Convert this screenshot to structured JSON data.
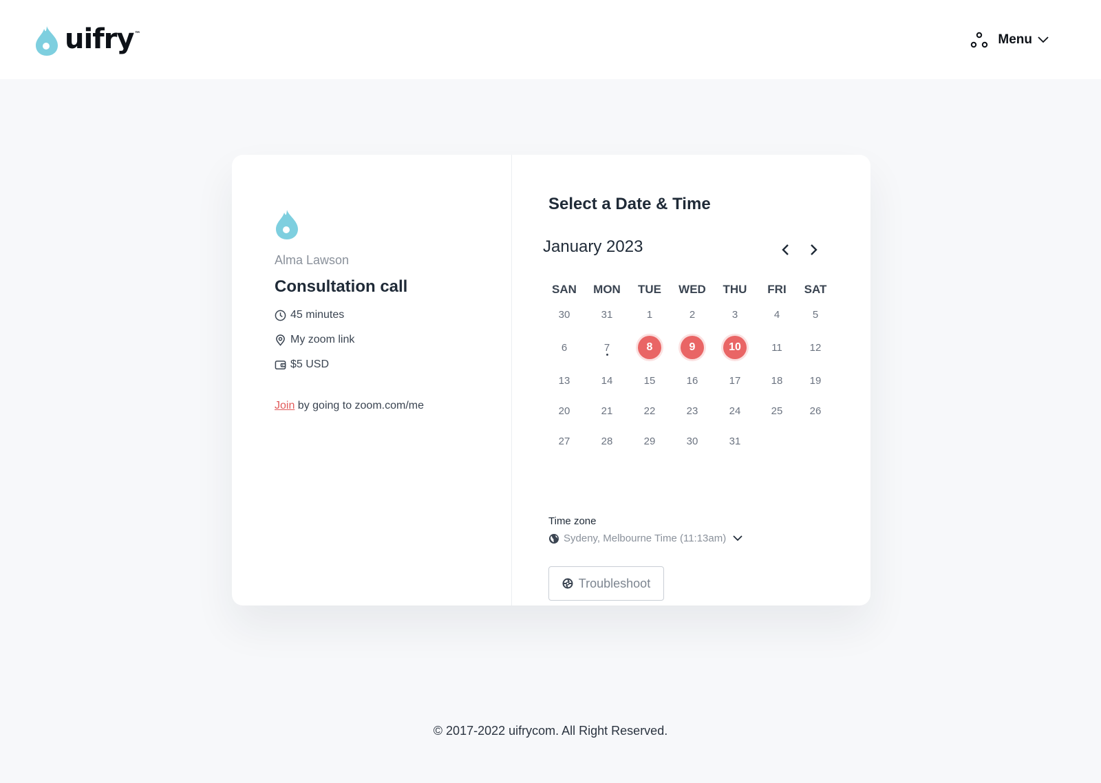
{
  "header": {
    "logo_text": "uifry",
    "logo_tm": "™",
    "menu_label": "Menu",
    "menu_icon": "people-dots-icon"
  },
  "event": {
    "host": "Alma Lawson",
    "title": "Consultation call",
    "duration": "45 minutes",
    "location": "My zoom link",
    "price": "$5 USD",
    "join_link": "Join",
    "join_text": " by going to zoom.com/me"
  },
  "calendar": {
    "title": "Select a Date & Time",
    "month": "January 2023",
    "weekdays": [
      "SAN",
      "MON",
      "TUE",
      "WED",
      "THU",
      "FRI",
      "SAT"
    ],
    "weeks": [
      [
        "30",
        "31",
        "1",
        "2",
        "3",
        "4",
        "5"
      ],
      [
        "6",
        "7",
        "8",
        "9",
        "10",
        "11",
        "12"
      ],
      [
        "13",
        "14",
        "15",
        "16",
        "17",
        "18",
        "19"
      ],
      [
        "20",
        "21",
        "22",
        "23",
        "24",
        "25",
        "26"
      ],
      [
        "27",
        "28",
        "29",
        "30",
        "31",
        "",
        ""
      ]
    ],
    "available_days": [
      "8",
      "9",
      "10"
    ],
    "today": "7",
    "accent_color": "#e96565"
  },
  "timezone": {
    "label": "Time zone",
    "value": "Sydeny, Melbourne Time (11:13am)"
  },
  "troubleshoot_label": "Troubleshoot",
  "footer": "© 2017-2022  uifrycom. All Right Reserved.",
  "colors": {
    "brand": "#7ecfdf",
    "accent": "#e96565",
    "background": "#f7f8fa"
  }
}
